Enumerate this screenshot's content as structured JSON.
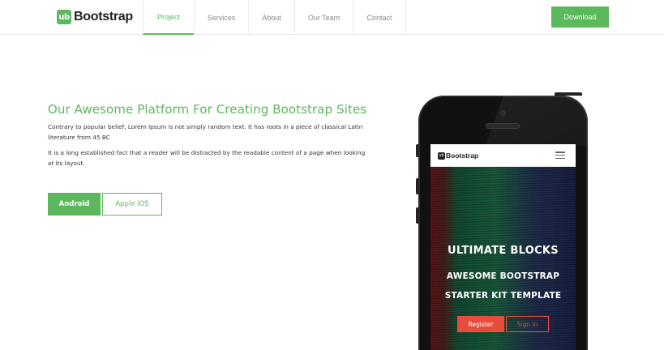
{
  "brand": {
    "badge": "ub",
    "name": "Bootstrap"
  },
  "nav": {
    "items": [
      {
        "label": "Project",
        "active": true
      },
      {
        "label": "Services",
        "active": false
      },
      {
        "label": "About",
        "active": false
      },
      {
        "label": "Our Team",
        "active": false
      },
      {
        "label": "Contact",
        "active": false
      }
    ],
    "download_label": "Download"
  },
  "hero": {
    "title": "Our Awesome Platform For Creating Bootstrap Sites",
    "paragraph1": "Contrary to popular belief, Lorem Ipsum is not simply random text. It has roots in a piece of classical Latin literature from 45 BC",
    "paragraph2": "It is a long established fact that a reader will be distracted by the readable content of a page when looking at its layout.",
    "android_label": "Android",
    "ios_label": "Apple iOS"
  },
  "phone_screen": {
    "brand_badge": "ub",
    "brand_name": "Bootstrap",
    "title1": "ULTIMATE BLOCKS",
    "title2": "AWESOME BOOTSTRAP",
    "title3": "STARTER KIT TEMPLATE",
    "register_label": "Register",
    "signin_label": "Sign In"
  },
  "colors": {
    "accent": "#5cb85c",
    "phone_button": "#e74c3c"
  }
}
